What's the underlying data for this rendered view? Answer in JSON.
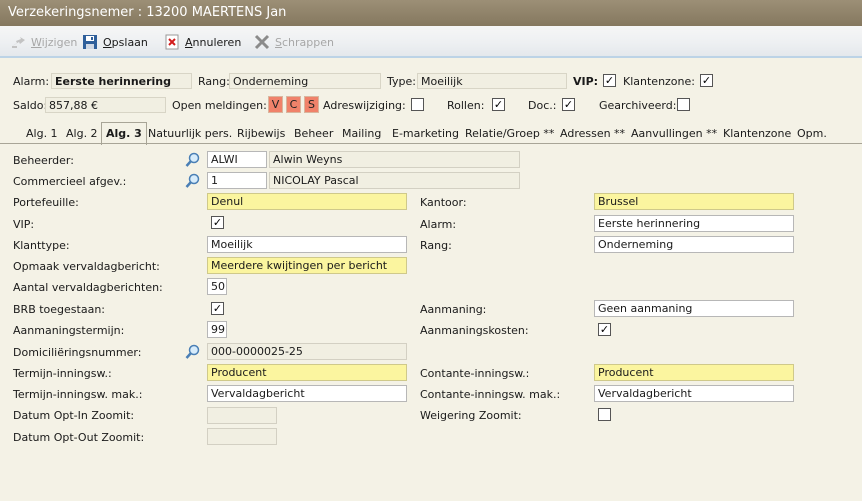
{
  "window": {
    "title": "Verzekeringsnemer : 13200 MAERTENS Jan"
  },
  "toolbar": {
    "wijzigen": "Wijzigen",
    "opslaan": "Opslaan",
    "annuleren": "Annuleren",
    "schrappen": "Schrappen"
  },
  "header": {
    "alarm_label": "Alarm:",
    "alarm_value": "Eerste herinnering",
    "rang_label": "Rang:",
    "rang_value": "Onderneming",
    "type_label": "Type:",
    "type_value": "Moeilijk",
    "vip_label": "VIP:",
    "vip_checked": true,
    "klantenzone_label": "Klantenzone:",
    "klantenzone_checked": true,
    "saldo_label": "Saldo:",
    "saldo_value": "857,88 €",
    "open_meldingen_label": "Open meldingen:",
    "meldingen": [
      "V",
      "C",
      "S"
    ],
    "adreswijziging_label": "Adreswijziging:",
    "adreswijziging_checked": false,
    "rollen_label": "Rollen:",
    "rollen_checked": true,
    "doc_label": "Doc.:",
    "doc_checked": true,
    "gearchiveerd_label": "Gearchiveerd:",
    "gearchiveerd_checked": false
  },
  "tabs": [
    "Alg. 1",
    "Alg. 2",
    "Alg. 3",
    "Natuurlijk pers.",
    "Rijbewijs",
    "Beheer",
    "Mailing",
    "E-marketing",
    "Relatie/Groep **",
    "Adressen **",
    "Aanvullingen **",
    "Klantenzone",
    "Opm."
  ],
  "active_tab": "Alg. 3",
  "form": {
    "beheerder": {
      "label": "Beheerder:",
      "code": "ALWI",
      "name": "Alwin Weyns"
    },
    "commercieel": {
      "label": "Commercieel afgev.:",
      "code": "1",
      "name": "NICOLAY Pascal"
    },
    "portefeuille": {
      "label": "Portefeuille:",
      "value": "Denul"
    },
    "kantoor": {
      "label": "Kantoor:",
      "value": "Brussel"
    },
    "vip": {
      "label": "VIP:",
      "checked": true
    },
    "alarm": {
      "label": "Alarm:",
      "value": "Eerste herinnering"
    },
    "klanttype": {
      "label": "Klanttype:",
      "value": "Moeilijk"
    },
    "rang": {
      "label": "Rang:",
      "value": "Onderneming"
    },
    "opmaak": {
      "label": "Opmaak vervaldagbericht:",
      "value": "Meerdere kwijtingen per bericht"
    },
    "aantal": {
      "label": "Aantal vervaldagberichten:",
      "value": "50"
    },
    "brb": {
      "label": "BRB toegestaan:",
      "checked": true
    },
    "aanmaning": {
      "label": "Aanmaning:",
      "value": "Geen aanmaning"
    },
    "aanmaningstermijn": {
      "label": "Aanmaningstermijn:",
      "value": "99"
    },
    "aanmaningskosten": {
      "label": "Aanmaningskosten:",
      "checked": true
    },
    "domiciliering": {
      "label": "Domiciliëringsnummer:",
      "value": "000-0000025-25"
    },
    "termijn": {
      "label": "Termijn-inningsw.:",
      "value": "Producent"
    },
    "contante": {
      "label": "Contante-inningsw.:",
      "value": "Producent"
    },
    "termijn_mak": {
      "label": "Termijn-inningsw. mak.:",
      "value": "Vervaldagbericht"
    },
    "contante_mak": {
      "label": "Contante-inningsw. mak.:",
      "value": "Vervaldagbericht"
    },
    "optin": {
      "label": "Datum Opt-In Zoomit:",
      "value": ""
    },
    "weigering": {
      "label": "Weigering Zoomit:",
      "checked": false
    },
    "optout": {
      "label": "Datum Opt-Out Zoomit:",
      "value": ""
    }
  },
  "colors": {
    "titlebar": "#8f826a",
    "required_field": "#fbf59f",
    "badge": "#f0826a",
    "background": "#f4f2e6"
  }
}
